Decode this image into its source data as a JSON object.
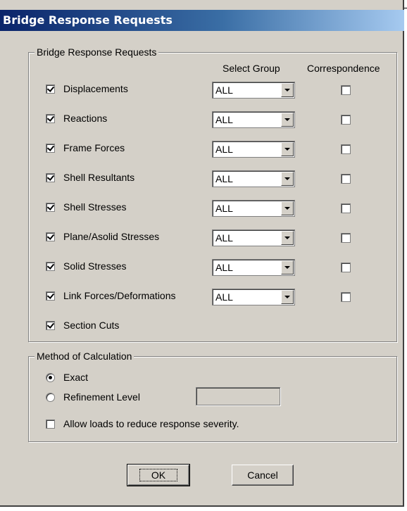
{
  "window": {
    "title": "Bridge Response Requests"
  },
  "requests": {
    "group_title": "Bridge Response Requests",
    "col_select_group": "Select Group",
    "col_correspondence": "Correspondence",
    "items": [
      {
        "label": "Displacements",
        "checked": true,
        "group": "ALL",
        "correspondence": false
      },
      {
        "label": "Reactions",
        "checked": true,
        "group": "ALL",
        "correspondence": false
      },
      {
        "label": "Frame Forces",
        "checked": true,
        "group": "ALL",
        "correspondence": false
      },
      {
        "label": "Shell Resultants",
        "checked": true,
        "group": "ALL",
        "correspondence": false
      },
      {
        "label": "Shell Stresses",
        "checked": true,
        "group": "ALL",
        "correspondence": false
      },
      {
        "label": "Plane/Asolid Stresses",
        "checked": true,
        "group": "ALL",
        "correspondence": false
      },
      {
        "label": "Solid Stresses",
        "checked": true,
        "group": "ALL",
        "correspondence": false
      },
      {
        "label": "Link Forces/Deformations",
        "checked": true,
        "group": "ALL",
        "correspondence": false
      },
      {
        "label": "Section Cuts",
        "checked": true
      }
    ]
  },
  "method": {
    "group_title": "Method of Calculation",
    "exact_label": "Exact",
    "exact_selected": true,
    "refinement_label": "Refinement Level",
    "refinement_value": "",
    "allow_loads_label": "Allow loads to reduce response severity.",
    "allow_loads_checked": false
  },
  "buttons": {
    "ok": "OK",
    "cancel": "Cancel"
  }
}
